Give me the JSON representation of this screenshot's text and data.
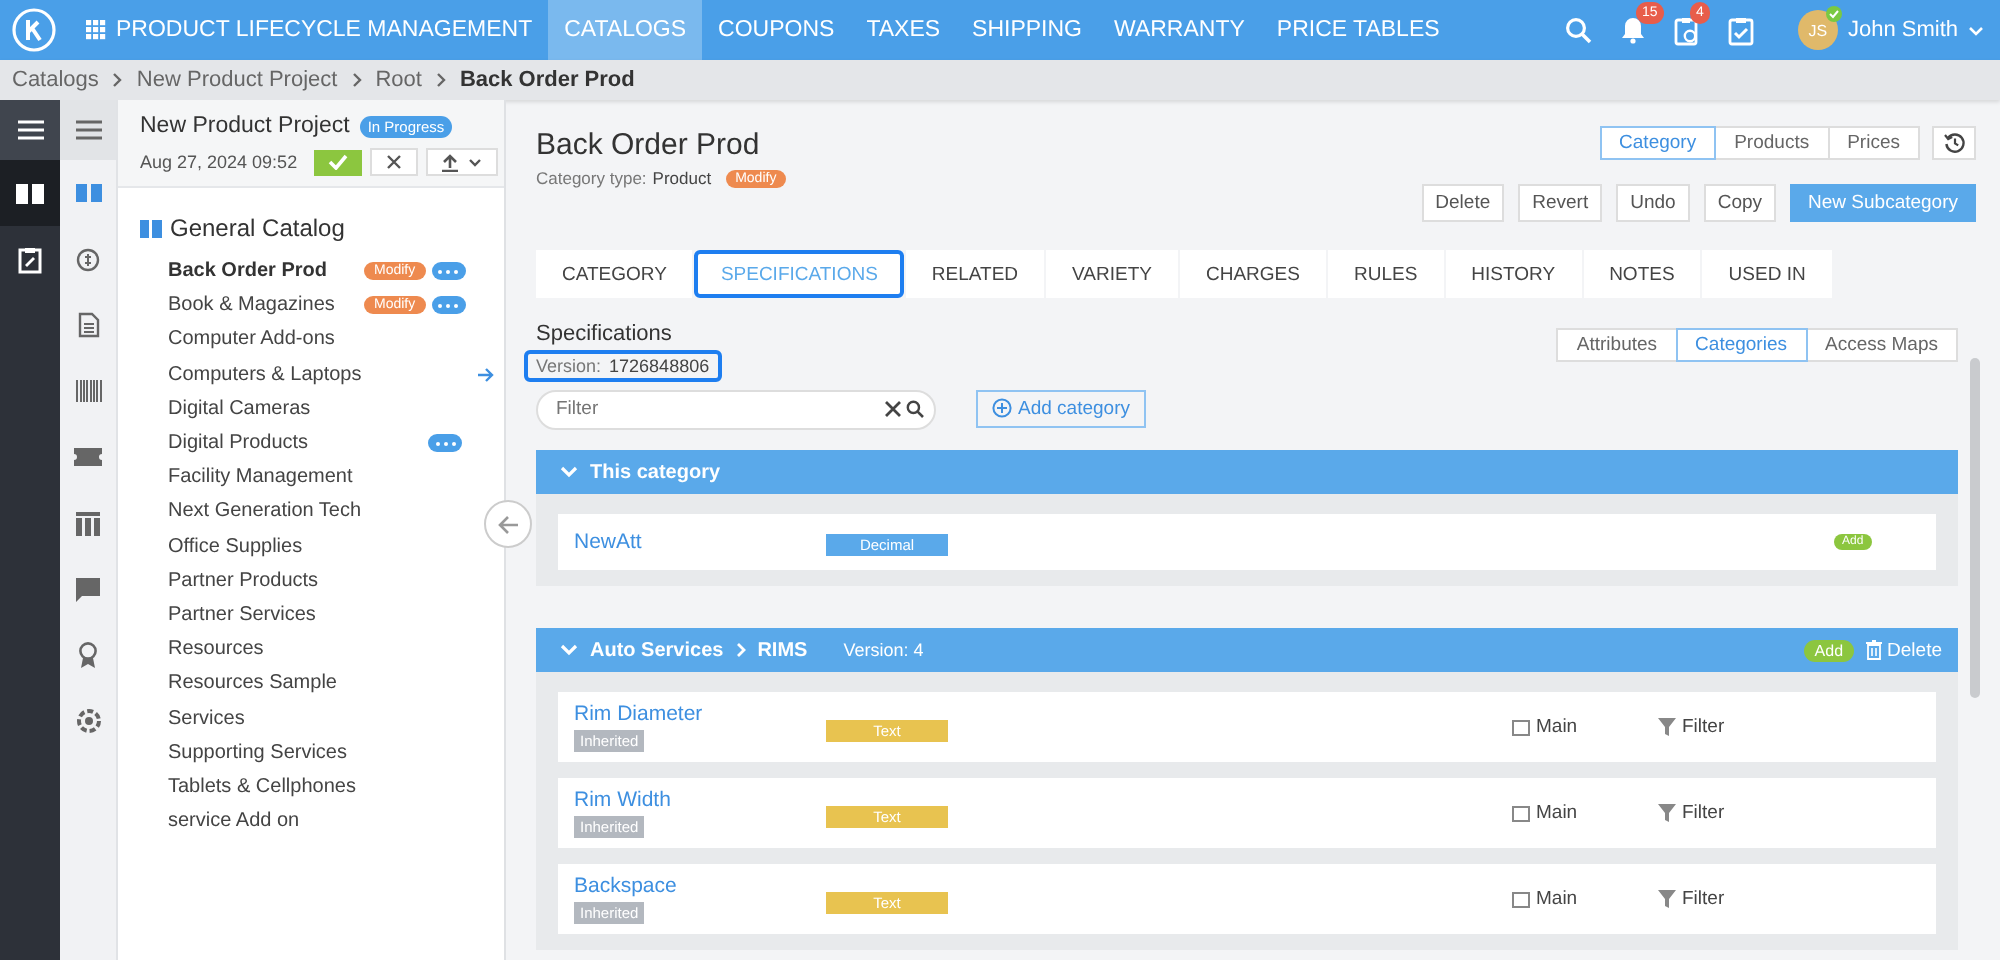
{
  "app": {
    "title": "PRODUCT LIFECYCLE MANAGEMENT"
  },
  "nav": [
    {
      "label": "CATALOGS",
      "selected": true
    },
    {
      "label": "COUPONS",
      "selected": false
    },
    {
      "label": "TAXES",
      "selected": false
    },
    {
      "label": "SHIPPING",
      "selected": false
    },
    {
      "label": "WARRANTY",
      "selected": false
    },
    {
      "label": "PRICE TABLES",
      "selected": false
    }
  ],
  "header": {
    "notifications": "15",
    "tasks": "4",
    "user": {
      "initials": "JS",
      "name": "John Smith",
      "online": true
    }
  },
  "breadcrumb": [
    {
      "label": "Catalogs",
      "current": false
    },
    {
      "label": "New Product Project",
      "current": false
    },
    {
      "label": "Root",
      "current": false
    },
    {
      "label": "Back Order Prod",
      "current": true
    }
  ],
  "project": {
    "name": "New Product Project",
    "status": "In Progress",
    "date": "Aug 27, 2024 09:52"
  },
  "tree": {
    "root": "General Catalog",
    "items": [
      {
        "label": "Back Order Prod",
        "selected": true,
        "badge": "Modify",
        "more": true,
        "expandable": false
      },
      {
        "label": "Book & Magazines",
        "selected": false,
        "badge": "Modify",
        "more": true,
        "expandable": false
      },
      {
        "label": "Computer Add-ons",
        "selected": false,
        "more": false,
        "expandable": false
      },
      {
        "label": "Computers & Laptops",
        "selected": false,
        "more": false,
        "expandable": true
      },
      {
        "label": "Digital Cameras",
        "selected": false,
        "more": false,
        "expandable": false
      },
      {
        "label": "Digital Products",
        "selected": false,
        "more": true,
        "expandable": false
      },
      {
        "label": "Facility Management",
        "selected": false,
        "more": false,
        "expandable": false
      },
      {
        "label": "Next Generation Tech",
        "selected": false,
        "more": false,
        "expandable": false
      },
      {
        "label": "Office Supplies",
        "selected": false,
        "more": false,
        "expandable": false
      },
      {
        "label": "Partner Products",
        "selected": false,
        "more": false,
        "expandable": false
      },
      {
        "label": "Partner Services",
        "selected": false,
        "more": false,
        "expandable": false
      },
      {
        "label": "Resources",
        "selected": false,
        "more": false,
        "expandable": false
      },
      {
        "label": "Resources Sample",
        "selected": false,
        "more": false,
        "expandable": false
      },
      {
        "label": "Services",
        "selected": false,
        "more": false,
        "expandable": false
      },
      {
        "label": "Supporting Services",
        "selected": false,
        "more": false,
        "expandable": false
      },
      {
        "label": "Tablets & Cellphones",
        "selected": false,
        "more": false,
        "expandable": false
      },
      {
        "label": "service Add on",
        "selected": false,
        "more": false,
        "expandable": false
      }
    ]
  },
  "page": {
    "title": "Back Order Prod",
    "type_label": "Category type:",
    "type": "Product",
    "badge": "Modify"
  },
  "view_tabs": [
    {
      "label": "Category",
      "selected": true
    },
    {
      "label": "Products",
      "selected": false
    },
    {
      "label": "Prices",
      "selected": false
    }
  ],
  "actions": [
    {
      "label": "Delete",
      "kind": "plain"
    },
    {
      "label": "Revert",
      "kind": "plain"
    },
    {
      "label": "Undo",
      "kind": "plain"
    },
    {
      "label": "Copy",
      "kind": "plain"
    },
    {
      "label": "New Subcategory",
      "kind": "primary"
    }
  ],
  "tabs": [
    {
      "label": "CATEGORY",
      "selected": false,
      "highlighted": false
    },
    {
      "label": "SPECIFICATIONS",
      "selected": true,
      "highlighted": true
    },
    {
      "label": "RELATED",
      "selected": false,
      "highlighted": false
    },
    {
      "label": "VARIETY",
      "selected": false,
      "highlighted": false
    },
    {
      "label": "CHARGES",
      "selected": false,
      "highlighted": false
    },
    {
      "label": "RULES",
      "selected": false,
      "highlighted": false
    },
    {
      "label": "HISTORY",
      "selected": false,
      "highlighted": false
    },
    {
      "label": "NOTES",
      "selected": false,
      "highlighted": false
    },
    {
      "label": "USED IN",
      "selected": false,
      "highlighted": false
    }
  ],
  "specifications": {
    "title": "Specifications",
    "version_label": "Version:",
    "version": "1726848806",
    "version_highlighted": true,
    "subtabs": [
      {
        "label": "Attributes",
        "selected": false
      },
      {
        "label": "Categories",
        "selected": true
      },
      {
        "label": "Access Maps",
        "selected": false
      }
    ],
    "filter": {
      "placeholder": "Filter"
    },
    "add_button": "Add category"
  },
  "groups": [
    {
      "path": [
        "This category"
      ],
      "rows": [
        {
          "name": "NewAtt",
          "type": "Decimal",
          "color": "#5aa9ea",
          "badge": "Add"
        }
      ]
    },
    {
      "path": [
        "Auto Services",
        "RIMS"
      ],
      "version": "Version: 4",
      "add": "Add",
      "delete": "Delete",
      "rows": [
        {
          "name": "Rim Diameter",
          "tag": "Inherited",
          "type": "Text",
          "color": "#e8c350",
          "main": {
            "label": "Main",
            "checked": false
          },
          "filter": "Filter"
        },
        {
          "name": "Rim Width",
          "tag": "Inherited",
          "type": "Text",
          "color": "#e8c350",
          "main": {
            "label": "Main",
            "checked": false
          },
          "filter": "Filter"
        },
        {
          "name": "Backspace",
          "tag": "Inherited",
          "type": "Text",
          "color": "#e8c350",
          "main": {
            "label": "Main",
            "checked": false
          },
          "filter": "Filter"
        }
      ]
    }
  ]
}
